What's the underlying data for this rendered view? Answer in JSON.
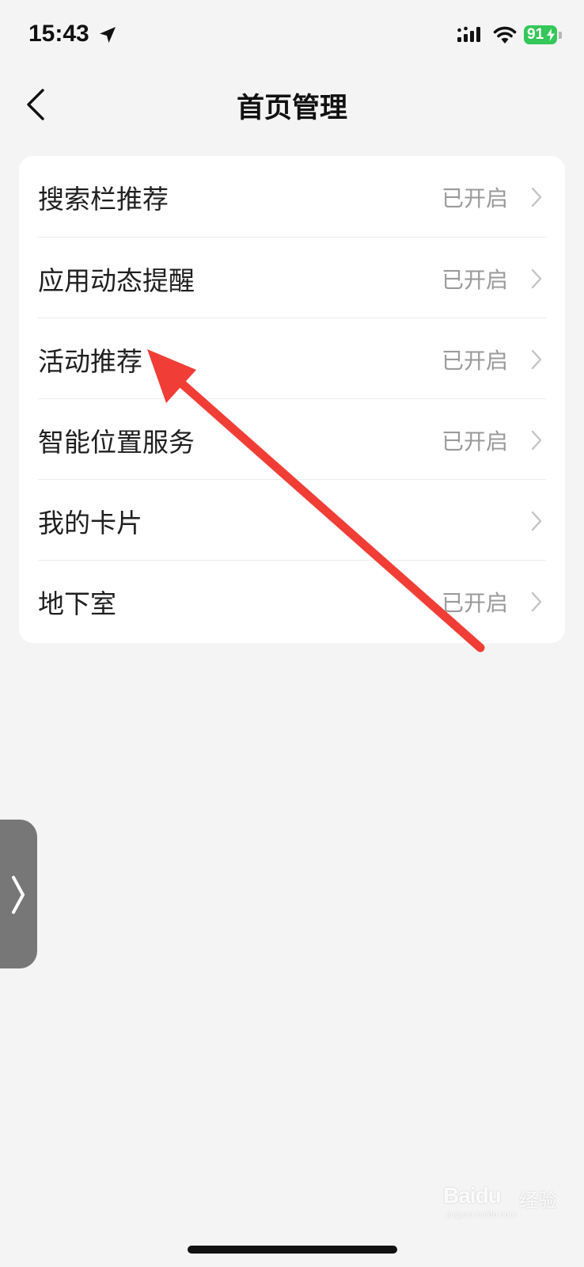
{
  "status_bar": {
    "time": "15:43",
    "battery": "91",
    "battery_color": "#34c759"
  },
  "nav": {
    "title": "首页管理",
    "back_icon": "chevron-left-icon"
  },
  "settings": {
    "items": [
      {
        "label": "搜索栏推荐",
        "status": "已开启"
      },
      {
        "label": "应用动态提醒",
        "status": "已开启"
      },
      {
        "label": "活动推荐",
        "status": "已开启"
      },
      {
        "label": "智能位置服务",
        "status": "已开启"
      },
      {
        "label": "我的卡片",
        "status": ""
      },
      {
        "label": "地下室",
        "status": "已开启"
      }
    ]
  },
  "annotation": {
    "arrow_color": "#f03e36"
  },
  "side_handle": {
    "icon": "chevron-right-icon",
    "color": "#777777"
  },
  "watermark": {
    "logo": "Baidu",
    "text": "经验",
    "url": "jingyan.baidu.com"
  }
}
